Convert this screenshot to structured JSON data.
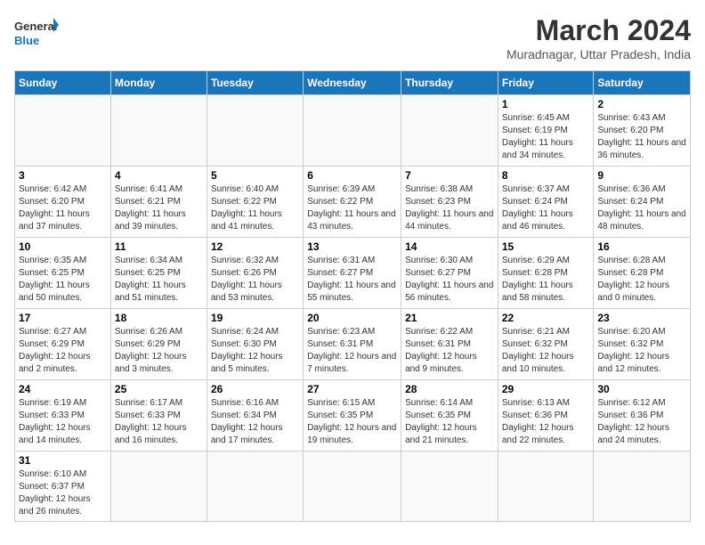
{
  "header": {
    "logo_general": "General",
    "logo_blue": "Blue",
    "month_year": "March 2024",
    "location": "Muradnagar, Uttar Pradesh, India"
  },
  "days_of_week": [
    "Sunday",
    "Monday",
    "Tuesday",
    "Wednesday",
    "Thursday",
    "Friday",
    "Saturday"
  ],
  "weeks": [
    [
      {
        "day": "",
        "info": ""
      },
      {
        "day": "",
        "info": ""
      },
      {
        "day": "",
        "info": ""
      },
      {
        "day": "",
        "info": ""
      },
      {
        "day": "",
        "info": ""
      },
      {
        "day": "1",
        "info": "Sunrise: 6:45 AM\nSunset: 6:19 PM\nDaylight: 11 hours\nand 34 minutes."
      },
      {
        "day": "2",
        "info": "Sunrise: 6:43 AM\nSunset: 6:20 PM\nDaylight: 11 hours\nand 36 minutes."
      }
    ],
    [
      {
        "day": "3",
        "info": "Sunrise: 6:42 AM\nSunset: 6:20 PM\nDaylight: 11 hours\nand 37 minutes."
      },
      {
        "day": "4",
        "info": "Sunrise: 6:41 AM\nSunset: 6:21 PM\nDaylight: 11 hours\nand 39 minutes."
      },
      {
        "day": "5",
        "info": "Sunrise: 6:40 AM\nSunset: 6:22 PM\nDaylight: 11 hours\nand 41 minutes."
      },
      {
        "day": "6",
        "info": "Sunrise: 6:39 AM\nSunset: 6:22 PM\nDaylight: 11 hours\nand 43 minutes."
      },
      {
        "day": "7",
        "info": "Sunrise: 6:38 AM\nSunset: 6:23 PM\nDaylight: 11 hours\nand 44 minutes."
      },
      {
        "day": "8",
        "info": "Sunrise: 6:37 AM\nSunset: 6:24 PM\nDaylight: 11 hours\nand 46 minutes."
      },
      {
        "day": "9",
        "info": "Sunrise: 6:36 AM\nSunset: 6:24 PM\nDaylight: 11 hours\nand 48 minutes."
      }
    ],
    [
      {
        "day": "10",
        "info": "Sunrise: 6:35 AM\nSunset: 6:25 PM\nDaylight: 11 hours\nand 50 minutes."
      },
      {
        "day": "11",
        "info": "Sunrise: 6:34 AM\nSunset: 6:25 PM\nDaylight: 11 hours\nand 51 minutes."
      },
      {
        "day": "12",
        "info": "Sunrise: 6:32 AM\nSunset: 6:26 PM\nDaylight: 11 hours\nand 53 minutes."
      },
      {
        "day": "13",
        "info": "Sunrise: 6:31 AM\nSunset: 6:27 PM\nDaylight: 11 hours\nand 55 minutes."
      },
      {
        "day": "14",
        "info": "Sunrise: 6:30 AM\nSunset: 6:27 PM\nDaylight: 11 hours\nand 56 minutes."
      },
      {
        "day": "15",
        "info": "Sunrise: 6:29 AM\nSunset: 6:28 PM\nDaylight: 11 hours\nand 58 minutes."
      },
      {
        "day": "16",
        "info": "Sunrise: 6:28 AM\nSunset: 6:28 PM\nDaylight: 12 hours\nand 0 minutes."
      }
    ],
    [
      {
        "day": "17",
        "info": "Sunrise: 6:27 AM\nSunset: 6:29 PM\nDaylight: 12 hours\nand 2 minutes."
      },
      {
        "day": "18",
        "info": "Sunrise: 6:26 AM\nSunset: 6:29 PM\nDaylight: 12 hours\nand 3 minutes."
      },
      {
        "day": "19",
        "info": "Sunrise: 6:24 AM\nSunset: 6:30 PM\nDaylight: 12 hours\nand 5 minutes."
      },
      {
        "day": "20",
        "info": "Sunrise: 6:23 AM\nSunset: 6:31 PM\nDaylight: 12 hours\nand 7 minutes."
      },
      {
        "day": "21",
        "info": "Sunrise: 6:22 AM\nSunset: 6:31 PM\nDaylight: 12 hours\nand 9 minutes."
      },
      {
        "day": "22",
        "info": "Sunrise: 6:21 AM\nSunset: 6:32 PM\nDaylight: 12 hours\nand 10 minutes."
      },
      {
        "day": "23",
        "info": "Sunrise: 6:20 AM\nSunset: 6:32 PM\nDaylight: 12 hours\nand 12 minutes."
      }
    ],
    [
      {
        "day": "24",
        "info": "Sunrise: 6:19 AM\nSunset: 6:33 PM\nDaylight: 12 hours\nand 14 minutes."
      },
      {
        "day": "25",
        "info": "Sunrise: 6:17 AM\nSunset: 6:33 PM\nDaylight: 12 hours\nand 16 minutes."
      },
      {
        "day": "26",
        "info": "Sunrise: 6:16 AM\nSunset: 6:34 PM\nDaylight: 12 hours\nand 17 minutes."
      },
      {
        "day": "27",
        "info": "Sunrise: 6:15 AM\nSunset: 6:35 PM\nDaylight: 12 hours\nand 19 minutes."
      },
      {
        "day": "28",
        "info": "Sunrise: 6:14 AM\nSunset: 6:35 PM\nDaylight: 12 hours\nand 21 minutes."
      },
      {
        "day": "29",
        "info": "Sunrise: 6:13 AM\nSunset: 6:36 PM\nDaylight: 12 hours\nand 22 minutes."
      },
      {
        "day": "30",
        "info": "Sunrise: 6:12 AM\nSunset: 6:36 PM\nDaylight: 12 hours\nand 24 minutes."
      }
    ],
    [
      {
        "day": "31",
        "info": "Sunrise: 6:10 AM\nSunset: 6:37 PM\nDaylight: 12 hours\nand 26 minutes."
      },
      {
        "day": "",
        "info": ""
      },
      {
        "day": "",
        "info": ""
      },
      {
        "day": "",
        "info": ""
      },
      {
        "day": "",
        "info": ""
      },
      {
        "day": "",
        "info": ""
      },
      {
        "day": "",
        "info": ""
      }
    ]
  ]
}
